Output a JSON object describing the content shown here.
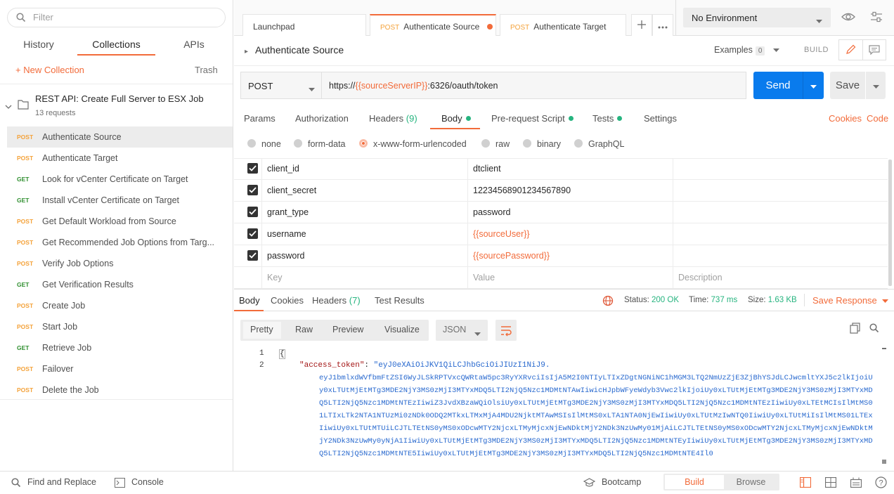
{
  "sidebar": {
    "filter_placeholder": "Filter",
    "tabs": [
      {
        "label": "History"
      },
      {
        "label": "Collections"
      },
      {
        "label": "APIs"
      }
    ],
    "new_collection": "+ New Collection",
    "trash": "Trash",
    "collection": {
      "name": "REST API: Create Full Server to ESX Job",
      "count": "13 requests"
    },
    "requests": [
      {
        "method": "POST",
        "name": "Authenticate Source"
      },
      {
        "method": "POST",
        "name": "Authenticate Target"
      },
      {
        "method": "GET",
        "name": "Look for vCenter Certificate on Target"
      },
      {
        "method": "GET",
        "name": "Install vCenter Certificate on Target"
      },
      {
        "method": "POST",
        "name": "Get Default Workload from Source"
      },
      {
        "method": "POST",
        "name": "Get Recommended Job Options from Targ..."
      },
      {
        "method": "POST",
        "name": "Verify Job Options"
      },
      {
        "method": "GET",
        "name": "Get Verification Results"
      },
      {
        "method": "POST",
        "name": "Create Job"
      },
      {
        "method": "POST",
        "name": "Start Job"
      },
      {
        "method": "GET",
        "name": "Retrieve Job"
      },
      {
        "method": "POST",
        "name": "Failover"
      },
      {
        "method": "POST",
        "name": "Delete the Job"
      }
    ]
  },
  "tabs": [
    {
      "method": "",
      "label": "Launchpad"
    },
    {
      "method": "POST",
      "label": "Authenticate Source"
    },
    {
      "method": "POST",
      "label": "Authenticate Target"
    }
  ],
  "environment": "No Environment",
  "request": {
    "title": "Authenticate Source",
    "examples_label": "Examples",
    "examples_count": "0",
    "build_label": "BUILD",
    "method": "POST",
    "url_prefix": "https://",
    "url_var": "{{sourceServerIP}}",
    "url_suffix": ":6326/oauth/token",
    "send": "Send",
    "save": "Save"
  },
  "request_tabs": {
    "params": "Params",
    "authorization": "Authorization",
    "headers": "Headers",
    "headers_count": "(9)",
    "body": "Body",
    "prerequest": "Pre-request Script",
    "tests": "Tests",
    "settings": "Settings",
    "cookies": "Cookies",
    "code": "Code"
  },
  "body_types": [
    "none",
    "form-data",
    "x-www-form-urlencoded",
    "raw",
    "binary",
    "GraphQL"
  ],
  "body_type_selected": "x-www-form-urlencoded",
  "form_rows": [
    {
      "key": "client_id",
      "value": "dtclient",
      "is_var": false
    },
    {
      "key": "client_secret",
      "value": "12234568901234567890",
      "is_var": false
    },
    {
      "key": "grant_type",
      "value": "password",
      "is_var": false
    },
    {
      "key": "username",
      "value": "{{sourceUser}}",
      "is_var": true
    },
    {
      "key": "password",
      "value": "{{sourcePassword}}",
      "is_var": true
    }
  ],
  "form_placeholders": {
    "key": "Key",
    "value": "Value",
    "description": "Description"
  },
  "response": {
    "tabs": {
      "body": "Body",
      "cookies": "Cookies",
      "headers": "Headers",
      "headers_count": "(7)",
      "tests": "Test Results"
    },
    "status_label": "Status:",
    "status": "200 OK",
    "time_label": "Time:",
    "time": "737 ms",
    "size_label": "Size:",
    "size": "1.63 KB",
    "save_response": "Save Response",
    "formats": [
      "Pretty",
      "Raw",
      "Preview",
      "Visualize"
    ],
    "format_type": "JSON",
    "line1": "{",
    "line2_key": "\"access_token\"",
    "line2_val": "\"eyJ0eXAiOiJKV1QiLCJhbGciOiJIUzI1NiJ9.",
    "token_continuation": "eyJ1bmlxdWVfbmFtZSI6WyJLSkRPTVxcQWRtaW5pc3RyYXRvciIsIjA5M2I0NTIyLTIxZDgtNGNiNC1hMGM3LTQ2NmUzZjE3ZjBhYSJdLCJwcmltYXJ5c2lkIjoiUy0xLTUtMjEtMTg3MDE2NjY3MS0zMjI3MTYxMDQ5LTI2NjQ5Nzc1MDMtNTAwIiwicHJpbWFyeWdyb3Vwc2lkIjoiUy0xLTUtMjEtMTg3MDE2NjY3MS0zMjI3MTYxMDQ5LTI2NjQ5Nzc1MDMtNTEzIiwiZ3JvdXBzaWQiOlsiUy0xLTUtMjEtMTg3MDE2NjY3MS0zMjI3MTYxMDQ5LTI2NjQ5Nzc1MDMtNTEzIiwiUy0xLTEtMCIsIlMtMS01LTIxLTk2NTA1NTUzMi0zNDk0ODQ2MTkxLTMxMjA4MDU2NjktMTAwMSIsIlMtMS0xLTA1NTA0NjEwIiwiUy0xLTUtMzIwNTQ0IiwiUy0xLTUtMiIsIlMtMS01LTExIiwiUy0xLTUtMTUiLCJTLTEtNS0yMS0xODcwMTY2NjcxLTMyMjcxNjEwNDktMjY2NDk3NzUwMy01MjAiLCJTLTEtNS0yMS0xODcwMTY2NjcxLTMyMjcxNjEwNDktMjY2NDk3NzUwMy0yNjA1IiwiUy0xLTUtMjEtMTg3MDE2NjY3MS0zMjI3MTYxMDQ5LTI2NjQ5Nzc1MDMtNTEyIiwiUy0xLTUtMjEtMTg3MDE2NjY3MS0zMjI3MTYxMDQ5LTI2NjQ5Nzc1MDMtNTE5IiwiUy0xLTUtMjEtMTg3MDE2NjY3MS0zMjI3MTYxMDQ5LTI2NjQ5Nzc1MDMtNTE4Il0"
  },
  "bottom": {
    "find_replace": "Find and Replace",
    "console": "Console",
    "bootcamp": "Bootcamp",
    "build": "Build",
    "browse": "Browse"
  }
}
